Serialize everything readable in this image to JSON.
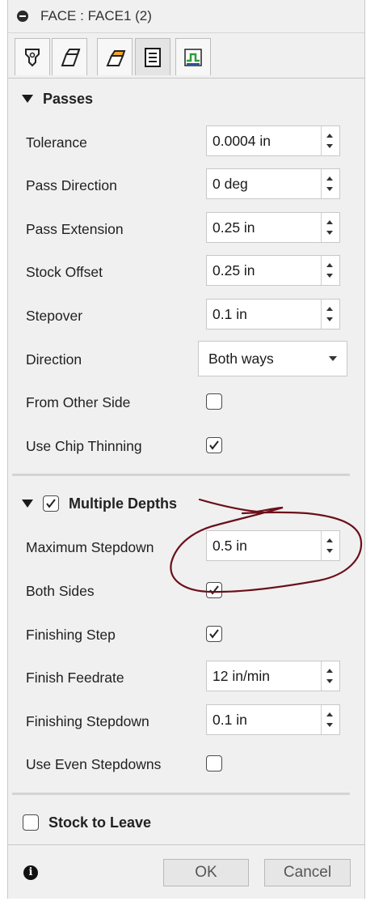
{
  "dialog": {
    "title": "FACE : FACE1 (2)"
  },
  "tabs": [
    {
      "icon": "tool-icon"
    },
    {
      "icon": "geometry-icon"
    },
    {
      "icon": "heights-icon"
    },
    {
      "icon": "passes-icon",
      "active": true
    },
    {
      "icon": "linking-icon"
    }
  ],
  "passes": {
    "header": "Passes",
    "tolerance": {
      "label": "Tolerance",
      "value": "0.0004 in"
    },
    "pass_direction": {
      "label": "Pass Direction",
      "value": "0 deg"
    },
    "pass_extension": {
      "label": "Pass Extension",
      "value": "0.25 in"
    },
    "stock_offset": {
      "label": "Stock Offset",
      "value": "0.25 in"
    },
    "stepover": {
      "label": "Stepover",
      "value": "0.1 in"
    },
    "direction": {
      "label": "Direction",
      "value": "Both ways"
    },
    "from_other_side": {
      "label": "From Other Side",
      "checked": false
    },
    "use_chip_thinning": {
      "label": "Use Chip Thinning",
      "checked": true
    }
  },
  "multiple_depths": {
    "header": "Multiple Depths",
    "checked": true,
    "maximum_stepdown": {
      "label": "Maximum Stepdown",
      "value": "0.5 in"
    },
    "both_sides": {
      "label": "Both Sides",
      "checked": true
    },
    "finishing_step": {
      "label": "Finishing Step",
      "checked": true
    },
    "finish_feedrate": {
      "label": "Finish Feedrate",
      "value": "12 in/min"
    },
    "finishing_stepdown": {
      "label": "Finishing Stepdown",
      "value": "0.1 in"
    },
    "use_even_stepdowns": {
      "label": "Use Even Stepdowns",
      "checked": false
    }
  },
  "stock_to_leave": {
    "header": "Stock to Leave",
    "checked": false
  },
  "footer": {
    "info_icon": "info-icon",
    "ok_label": "OK",
    "cancel_label": "Cancel"
  },
  "colors": {
    "panel_bg": "#f0f0f0",
    "annotation_ink": "#6b0f1a",
    "tab_accent_orange": "#f5a623",
    "tab_accent_green": "#2e9d3a",
    "tab_accent_blue": "#1f4fa8"
  }
}
